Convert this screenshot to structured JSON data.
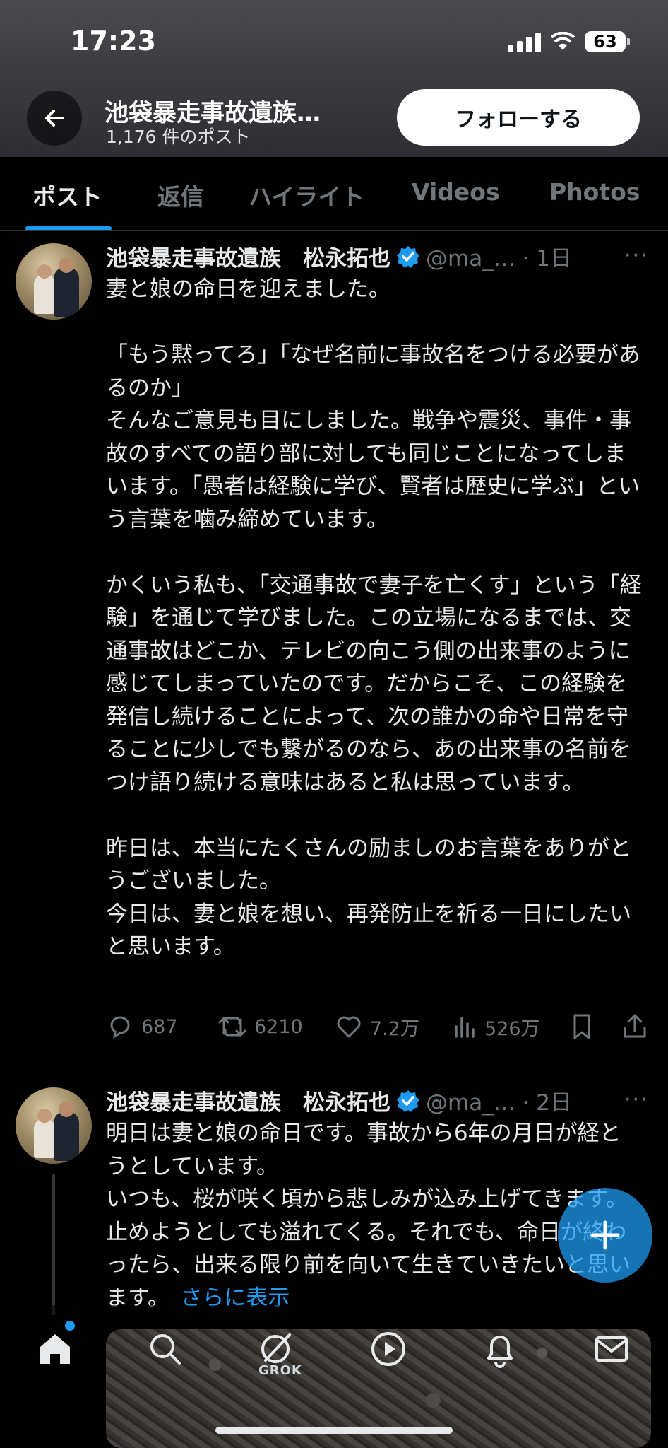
{
  "status_bar": {
    "time": "17:23",
    "battery": "63"
  },
  "header": {
    "title": "池袋暴走事故遺族…",
    "post_count": "1,176 件のポスト",
    "follow_label": "フォローする"
  },
  "tabs": [
    {
      "label": "ポスト"
    },
    {
      "label": "返信"
    },
    {
      "label": "ハイライト"
    },
    {
      "label": "Videos"
    },
    {
      "label": "Photos"
    }
  ],
  "posts": [
    {
      "name": "池袋暴走事故遺族　松永拓也",
      "handle": "@ma_… · 1日",
      "text": "妻と娘の命日を迎えました。\n\n「もう黙ってろ」「なぜ名前に事故名をつける必要があるのか」\nそんなご意見も目にしました。戦争や震災、事件・事故のすべての語り部に対しても同じことになってしまいます。「愚者は経験に学び、賢者は歴史に学ぶ」という言葉を噛み締めています。\n\nかくいう私も、「交通事故で妻子を亡くす」という「経験」を通じて学びました。この立場になるまでは、交通事故はどこか、テレビの向こう側の出来事のように感じてしまっていたのです。だからこそ、この経験を発信し続けることによって、次の誰かの命や日常を守ることに少しでも繋がるのなら、あの出来事の名前をつけ語り続ける意味はあると私は思っています。\n\n昨日は、本当にたくさんの励ましのお言葉をありがとうございました。\n今日は、妻と娘を想い、再発防止を祈る一日にしたいと思います。",
      "replies": "687",
      "reposts": "6210",
      "likes": "7.2万",
      "views": "526万"
    },
    {
      "name": "池袋暴走事故遺族　松永拓也",
      "handle": "@ma_… · 2日",
      "text": "明日は妻と娘の命日です。事故から6年の月日が経とうとしています。\nいつも、桜が咲く頃から悲しみが込み上げてきます。止めようとしても溢れてくる。それでも、命日が終わったら、出来る限り前を向いて生きていきたいと思います。",
      "show_more": "さらに表示"
    }
  ],
  "bottom_nav": {
    "grok_label": "GROK"
  },
  "colors": {
    "accent": "#1d9bf0",
    "background": "#000000",
    "muted": "#71767b"
  }
}
